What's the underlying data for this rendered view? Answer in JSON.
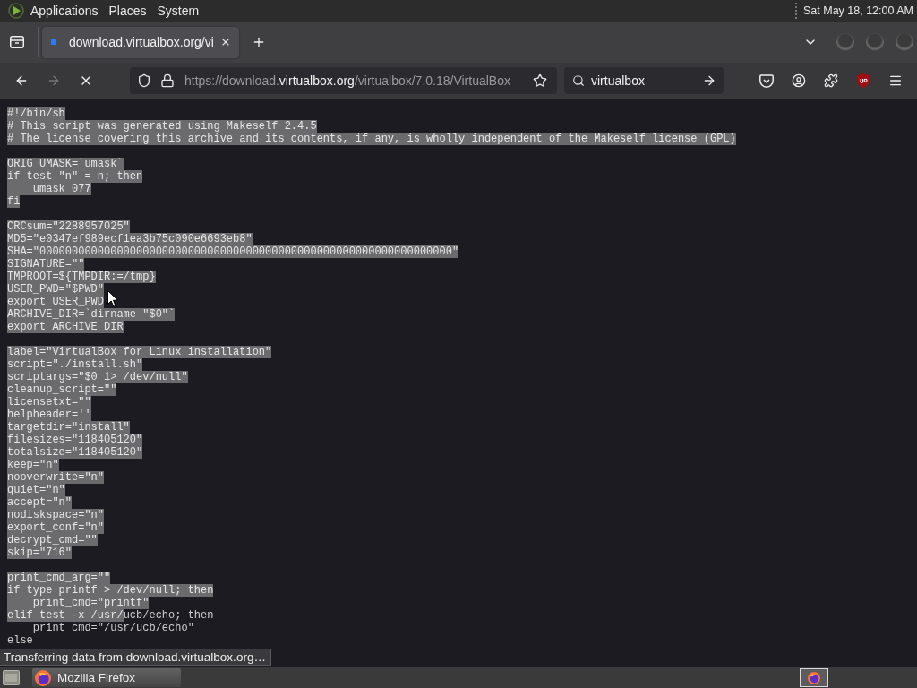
{
  "top_panel": {
    "menus": [
      "Applications",
      "Places",
      "System"
    ],
    "clock": "Sat May 18, 12:00 AM"
  },
  "tabs": [
    {
      "title": "download.virtualbox.org/vi",
      "selected": true
    }
  ],
  "toolbar": {
    "buttons": [
      {
        "kind": "back",
        "disabled": false
      },
      {
        "kind": "forward",
        "disabled": true
      },
      {
        "kind": "stop",
        "disabled": false
      }
    ],
    "url": {
      "prefix": "https://download.",
      "domain": "virtualbox.org",
      "path": "/virtualbox/7.0.18/VirtualBox"
    },
    "search": {
      "value": "virtualbox"
    }
  },
  "document": {
    "blocks": [
      {
        "lines": [
          [
            {
              "text": "#!/bin/sh",
              "selected": true
            }
          ],
          [
            {
              "text": "# This script was generated using Makeself 2.4.5",
              "selected": true
            }
          ],
          [
            {
              "text": "# The license covering this archive and its contents, if any, is wholly independent of the Makeself license (GPL)",
              "selected": true
            }
          ]
        ]
      },
      {
        "lines": [
          [
            {
              "text": "ORIG_UMASK=`umask`",
              "selected": true
            }
          ],
          [
            {
              "text": "if test \"n\" = n; then",
              "selected": true
            }
          ],
          [
            {
              "text": "    umask 077",
              "selected": true
            }
          ],
          [
            {
              "text": "fi",
              "selected": true
            }
          ]
        ]
      },
      {
        "lines": [
          [
            {
              "text": "CRCsum=\"2288957025\"",
              "selected": true
            }
          ],
          [
            {
              "text": "MD5=\"e0347ef989ecf1ea3b75c090e6693eb8\"",
              "selected": true
            }
          ],
          [
            {
              "text": "SHA=\"0000000000000000000000000000000000000000000000000000000000000000\"",
              "selected": true
            }
          ],
          [
            {
              "text": "SIGNATURE=\"\"",
              "selected": true
            }
          ],
          [
            {
              "text": "TMPROOT=${TMPDIR:=/tmp}",
              "selected": true
            }
          ],
          [
            {
              "text": "USER_PWD=\"$PWD\"",
              "selected": true
            }
          ],
          [
            {
              "text": "export USER_PWD",
              "selected": true
            }
          ],
          [
            {
              "text": "ARCHIVE_DIR=`dirname \"$0\"`",
              "selected": true
            }
          ],
          [
            {
              "text": "export ARCHIVE_DIR",
              "selected": true
            }
          ]
        ]
      },
      {
        "lines": [
          [
            {
              "text": "label=\"VirtualBox for Linux installation\"",
              "selected": true
            }
          ],
          [
            {
              "text": "script=\"./install.sh\"",
              "selected": true
            }
          ],
          [
            {
              "text": "scriptargs=\"$0 1> /dev/null\"",
              "selected": true
            }
          ],
          [
            {
              "text": "cleanup_script=\"\"",
              "selected": true
            }
          ],
          [
            {
              "text": "licensetxt=\"\"",
              "selected": true
            }
          ],
          [
            {
              "text": "helpheader=''",
              "selected": true
            }
          ],
          [
            {
              "text": "targetdir=\"install\"",
              "selected": true
            }
          ],
          [
            {
              "text": "filesizes=\"118405120\"",
              "selected": true
            }
          ],
          [
            {
              "text": "totalsize=\"118405120\"",
              "selected": true
            }
          ],
          [
            {
              "text": "keep=\"n\"",
              "selected": true
            }
          ],
          [
            {
              "text": "nooverwrite=\"n\"",
              "selected": true
            }
          ],
          [
            {
              "text": "quiet=\"n\"",
              "selected": true
            }
          ],
          [
            {
              "text": "accept=\"n\"",
              "selected": true
            }
          ],
          [
            {
              "text": "nodiskspace=\"n\"",
              "selected": true
            }
          ],
          [
            {
              "text": "export_conf=\"n\"",
              "selected": true
            }
          ],
          [
            {
              "text": "decrypt_cmd=\"\"",
              "selected": true
            }
          ],
          [
            {
              "text": "skip=\"716\"",
              "selected": true
            }
          ]
        ]
      },
      {
        "lines": [
          [
            {
              "text": "print_cmd_arg=\"\"",
              "selected": true
            }
          ],
          [
            {
              "text": "if type printf > /dev/null; then",
              "selected": true
            }
          ],
          [
            {
              "text": "    print_cmd=\"printf\"",
              "selected": true
            }
          ],
          [
            {
              "text": "elif test -x /usr/",
              "selected": true
            },
            {
              "text": "ucb/echo; then",
              "selected": false
            }
          ],
          [
            {
              "text": "    print_cmd=\"/usr/ucb/echo\"",
              "selected": false
            }
          ],
          [
            {
              "text": "else",
              "selected": false
            }
          ]
        ]
      }
    ]
  },
  "status": "Transferring data from download.virtualbox.org…",
  "taskbar": {
    "tasks": [
      {
        "title": "Mozilla Firefox",
        "selected": true
      }
    ]
  }
}
